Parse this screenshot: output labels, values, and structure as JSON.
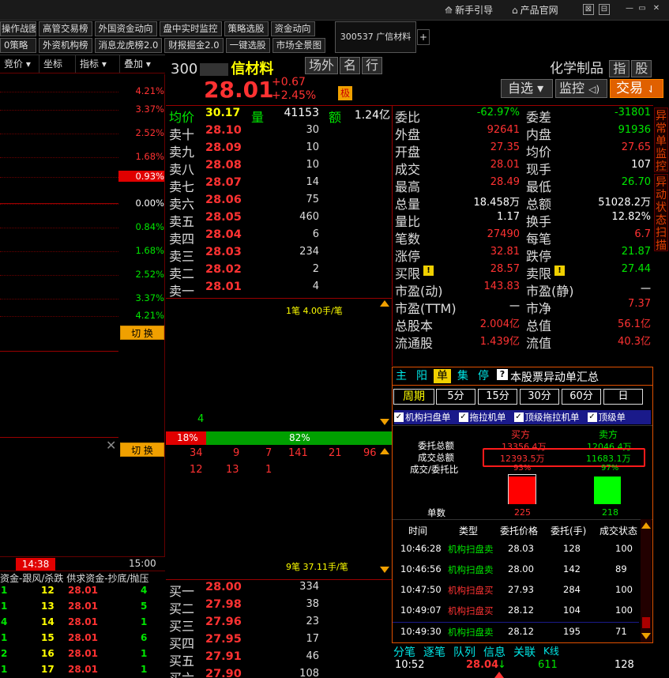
{
  "topbar": {
    "guide": "新手引导",
    "official": "产品官网"
  },
  "nav_row1": [
    "策略选股",
    "高管交易榜",
    "外国资金动向",
    "盘中实时监控",
    "策略选股",
    "资金动向"
  ],
  "nav_row2": [
    "0策略",
    "外资机构榜",
    "消息龙虎榜2.0",
    "财报掘金2.0",
    "一键选股",
    "市场全景图"
  ],
  "nav_row1_first": "操作战图",
  "stock_tab": "300537 广信材料",
  "plus": "+",
  "left_header": [
    "竞价",
    "坐标",
    "指标",
    "叠加"
  ],
  "left_pcts": [
    {
      "t": "4.21%",
      "c": "red"
    },
    {
      "t": "3.37%",
      "c": "red"
    },
    {
      "t": "2.52%",
      "c": "red"
    },
    {
      "t": "1.68%",
      "c": "red"
    },
    {
      "t": "0.93%",
      "c": "hl"
    },
    {
      "t": "0.00%",
      "c": "white"
    },
    {
      "t": "0.84%",
      "c": "green"
    },
    {
      "t": "1.68%",
      "c": "green"
    },
    {
      "t": "2.52%",
      "c": "green"
    },
    {
      "t": "3.37%",
      "c": "green"
    },
    {
      "t": "4.21%",
      "c": "green"
    }
  ],
  "switch_label": "切 换",
  "time_marks": [
    "14:38",
    "15:00"
  ],
  "left_bottom_header": "资金-跟风/杀跌  供求资金-抄底/抛压",
  "left_bottom_rows": [
    {
      "a": "1",
      "b": "12",
      "p": "28.01",
      "c": "4"
    },
    {
      "a": "1",
      "b": "13",
      "p": "28.01",
      "c": "5"
    },
    {
      "a": "4",
      "b": "14",
      "p": "28.01",
      "c": "1"
    },
    {
      "a": "1",
      "b": "15",
      "p": "28.01",
      "c": "6"
    },
    {
      "a": "2",
      "b": "16",
      "p": "28.01",
      "c": "1"
    },
    {
      "a": "1",
      "b": "17",
      "p": "28.01",
      "c": "1"
    }
  ],
  "stock": {
    "code": "300",
    "name": "信材料",
    "price": "28.01",
    "change": "+0.67",
    "change_pct": "+2.45%",
    "tag": "极",
    "industry": "化学制品",
    "btn_idx": "指",
    "btn_stock": "股",
    "btn_out": "场外",
    "btn_name": "名",
    "btn_row": "行"
  },
  "actions": {
    "watch": "自选",
    "monitor": "监控",
    "trade": "交易"
  },
  "avg_row": {
    "avg_label": "均价",
    "avg": "30.17",
    "vol_label": "量",
    "vol": "41153",
    "amt_label": "额",
    "amt": "1.24亿"
  },
  "sells": [
    {
      "l": "卖十",
      "p": "28.10",
      "v": "30"
    },
    {
      "l": "卖九",
      "p": "28.09",
      "v": "10"
    },
    {
      "l": "卖八",
      "p": "28.08",
      "v": "10"
    },
    {
      "l": "卖七",
      "p": "28.07",
      "v": "14"
    },
    {
      "l": "卖六",
      "p": "28.06",
      "v": "75"
    },
    {
      "l": "卖五",
      "p": "28.05",
      "v": "460"
    },
    {
      "l": "卖四",
      "p": "28.04",
      "v": "6"
    },
    {
      "l": "卖三",
      "p": "28.03",
      "v": "234"
    },
    {
      "l": "卖二",
      "p": "28.02",
      "v": "2"
    },
    {
      "l": "卖一",
      "p": "28.01",
      "v": "4"
    }
  ],
  "buys": [
    {
      "l": "买一",
      "p": "28.00",
      "v": "334"
    },
    {
      "l": "买二",
      "p": "27.98",
      "v": "38"
    },
    {
      "l": "买三",
      "p": "27.96",
      "v": "23"
    },
    {
      "l": "买四",
      "p": "27.95",
      "v": "17"
    },
    {
      "l": "买五",
      "p": "27.91",
      "v": "46"
    },
    {
      "l": "买六",
      "p": "27.90",
      "v": "108"
    }
  ],
  "queue_top": "1笔 4.00手/笔",
  "queue_bottom": "9笔 37.11手/笔",
  "queue_four": "4",
  "ratio": {
    "left": "18%",
    "right": "82%",
    "left_frac": 0.18
  },
  "ticks_row1": [
    "34",
    "9",
    "7",
    "141",
    "21",
    "96"
  ],
  "ticks_row2": [
    "12",
    "13",
    "1"
  ],
  "info": [
    {
      "l1": "委比",
      "v1": "-62.97%",
      "c1": "green",
      "l2": "委差",
      "v2": "-31801",
      "c2": "green"
    },
    {
      "l1": "外盘",
      "v1": "92641",
      "c1": "red",
      "l2": "内盘",
      "v2": "91936",
      "c2": "green"
    },
    {
      "l1": "开盘",
      "v1": "27.35",
      "c1": "red",
      "l2": "均价",
      "v2": "27.65",
      "c2": "red"
    },
    {
      "l1": "成交",
      "v1": "28.01",
      "c1": "red",
      "l2": "现手",
      "v2": "107",
      "c2": "white"
    },
    {
      "l1": "最高",
      "v1": "28.49",
      "c1": "red",
      "l2": "最低",
      "v2": "26.70",
      "c2": "green"
    },
    {
      "l1": "总量",
      "v1": "18.458万",
      "c1": "white",
      "l2": "总额",
      "v2": "51028.2万",
      "c2": "white"
    },
    {
      "l1": "量比",
      "v1": "1.17",
      "c1": "white",
      "l2": "换手",
      "v2": "12.82%",
      "c2": "white"
    },
    {
      "l1": "笔数",
      "v1": "27490",
      "c1": "red",
      "l2": "每笔",
      "v2": "6.7",
      "c2": "red"
    },
    {
      "l1": "涨停",
      "v1": "32.81",
      "c1": "red",
      "l2": "跌停",
      "v2": "21.87",
      "c2": "green"
    },
    {
      "l1": "买限",
      "v1": "28.57",
      "c1": "red",
      "l2": "卖限",
      "v2": "27.44",
      "c2": "green"
    },
    {
      "l1": "市盈(动)",
      "v1": "143.83",
      "c1": "red",
      "l2": "市盈(静)",
      "v2": "一",
      "c2": "white"
    },
    {
      "l1": "市盈(TTM)",
      "v1": "一",
      "c1": "white",
      "l2": "市净",
      "v2": "7.37",
      "c2": "red"
    },
    {
      "l1": "总股本",
      "v1": "2.004亿",
      "c1": "red",
      "l2": "总值",
      "v2": "56.1亿",
      "c2": "red"
    },
    {
      "l1": "流通股",
      "v1": "1.439亿",
      "c1": "red",
      "l2": "流值",
      "v2": "40.3亿",
      "c2": "red"
    }
  ],
  "panel": {
    "tabs": [
      "主",
      "阳",
      "单",
      "集",
      "停"
    ],
    "title": "本股票异动单汇总",
    "period_label": "周期",
    "periods": [
      "5分",
      "15分",
      "30分",
      "60分",
      "日"
    ],
    "checks": [
      "机构扫盘单",
      "拖拉机单",
      "顶级拖拉机单",
      "顶级单"
    ],
    "buy_label": "买方",
    "sell_label": "卖方",
    "row_labels": [
      "委托总额",
      "成交总额",
      "成交/委托比",
      "单数"
    ],
    "buy_entrust": "13356.4万",
    "sell_entrust": "12046.4万",
    "buy_deal": "12393.5万",
    "sell_deal": "11683.1万",
    "buy_ratio": "93%",
    "sell_ratio": "97%",
    "buy_count": "225",
    "sell_count": "218",
    "buy_fill": 0.93,
    "sell_fill": 0.97,
    "table_head": [
      "时间",
      "类型",
      "委托价格",
      "委托(手)",
      "成交状态"
    ],
    "rows": [
      {
        "t": "10:46:28",
        "k": "机构扫盘卖",
        "p": "28.03",
        "q": "128",
        "s": "100",
        "kc": "green"
      },
      {
        "t": "10:46:56",
        "k": "机构扫盘卖",
        "p": "28.00",
        "q": "142",
        "s": "89",
        "kc": "green"
      },
      {
        "t": "10:47:50",
        "k": "机构扫盘买",
        "p": "27.93",
        "q": "284",
        "s": "100",
        "kc": "red"
      },
      {
        "t": "10:49:07",
        "k": "机构扫盘买",
        "p": "28.12",
        "q": "104",
        "s": "100",
        "kc": "red"
      },
      {
        "t": "10:49:30",
        "k": "机构扫盘卖",
        "p": "28.12",
        "q": "195",
        "s": "71",
        "kc": "green"
      }
    ]
  },
  "bottom_tabs": [
    "分笔",
    "逐笔",
    "队列",
    "信息",
    "关联",
    "K线"
  ],
  "bottom_row": {
    "t": "10:52",
    "p": "28.04",
    "v": "611",
    "n": "128"
  },
  "side1": "异常单监控",
  "side2": "异动状态扫描",
  "colors": {
    "up": "#ff3232",
    "down": "#00e600",
    "accent": "#f0a000",
    "border": "#600000"
  }
}
